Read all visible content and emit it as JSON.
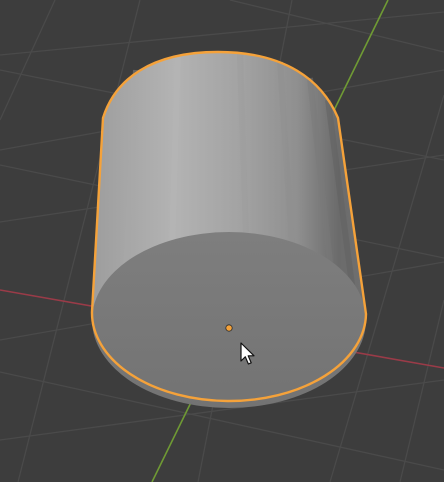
{
  "viewport": {
    "background_color": "#3d3d3d",
    "grid_color": "#4b4b4b"
  },
  "axes": {
    "x_axis_color": "#9a3b48",
    "y_axis_color": "#6f9a34"
  },
  "object": {
    "type": "cylinder",
    "state": "selected",
    "outline_color": "#f5a23a",
    "side_color": "#a4a4a4",
    "cap_color": "#7b7b7b",
    "origin_color": "#f5a23a"
  },
  "cursor": {
    "icon": "arrow-cursor-icon"
  }
}
